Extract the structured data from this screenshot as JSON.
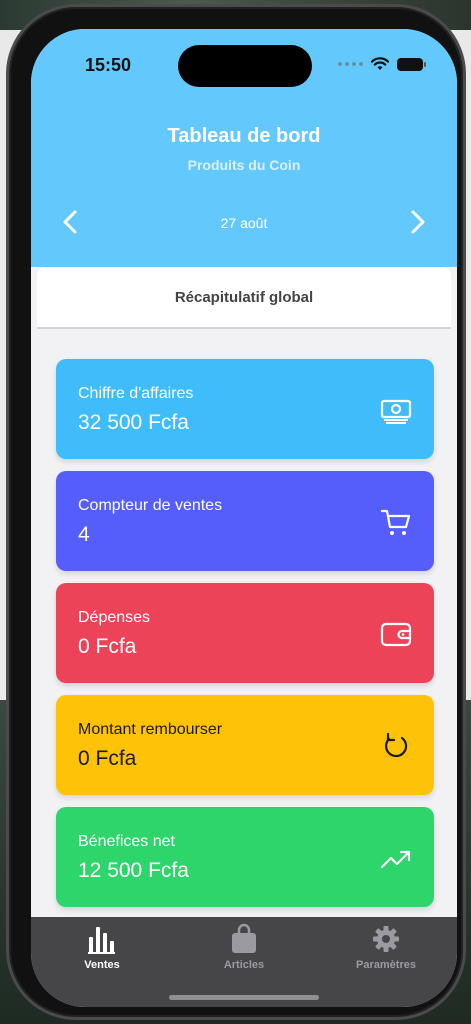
{
  "status_bar": {
    "time": "15:50"
  },
  "header": {
    "title": "Tableau de bord",
    "subtitle": "Produits du Coin",
    "date": "27 août"
  },
  "section": {
    "title": "Récapitulatif global"
  },
  "cards": [
    {
      "label": "Chiffre d'affaires",
      "value": "32 500 Fcfa",
      "icon": "money-icon",
      "color": "#3fbdfb"
    },
    {
      "label": "Compteur de ventes",
      "value": "4",
      "icon": "cart-icon",
      "color": "#555dfb"
    },
    {
      "label": "Dépenses",
      "value": "0 Fcfa",
      "icon": "wallet-icon",
      "color": "#ec4359"
    },
    {
      "label": "Montant rembourser",
      "value": "0 Fcfa",
      "icon": "refresh-icon",
      "color": "#fec307"
    },
    {
      "label": "Bénefices net",
      "value": "12 500 Fcfa",
      "icon": "trending-up-icon",
      "color": "#2dd56a"
    }
  ],
  "tabs": [
    {
      "label": "Ventes",
      "icon": "bar-chart-icon",
      "active": true
    },
    {
      "label": "Articles",
      "icon": "bag-icon",
      "active": false
    },
    {
      "label": "Paramètres",
      "icon": "gear-icon",
      "active": false
    }
  ]
}
